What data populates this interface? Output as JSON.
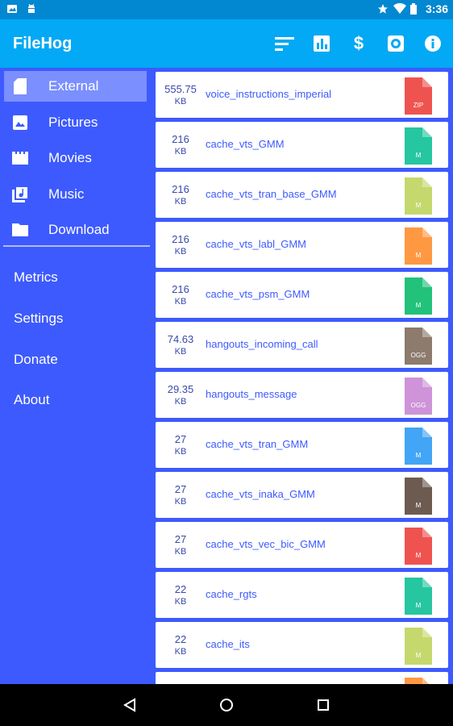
{
  "status_bar": {
    "time": "3:36",
    "icons": [
      "photo-notification-icon",
      "android-icon",
      "star-icon",
      "wifi-icon",
      "battery-icon"
    ]
  },
  "app_bar": {
    "title": "FileHog",
    "actions": [
      "sort-icon",
      "chart-icon",
      "dollar-icon",
      "settings-icon",
      "info-icon"
    ]
  },
  "drawer": {
    "items": [
      {
        "label": "External",
        "icon": "sd-card-icon",
        "selected": true
      },
      {
        "label": "Pictures",
        "icon": "image-icon"
      },
      {
        "label": "Movies",
        "icon": "movie-icon"
      },
      {
        "label": "Music",
        "icon": "music-library-icon"
      },
      {
        "label": "Download",
        "icon": "folder-icon"
      }
    ],
    "links": [
      "Metrics",
      "Settings",
      "Donate",
      "About"
    ]
  },
  "files": [
    {
      "size": "555.75",
      "unit": "KB",
      "name": "voice_instructions_imperial",
      "ext": "ZIP",
      "color": "#ef5350"
    },
    {
      "size": "216",
      "unit": "KB",
      "name": "cache_vts_GMM",
      "ext": "M",
      "color": "#26c6a0"
    },
    {
      "size": "216",
      "unit": "KB",
      "name": "cache_vts_tran_base_GMM",
      "ext": "M",
      "color": "#c5d86d"
    },
    {
      "size": "216",
      "unit": "KB",
      "name": "cache_vts_labl_GMM",
      "ext": "M",
      "color": "#ff9843"
    },
    {
      "size": "216",
      "unit": "KB",
      "name": "cache_vts_psm_GMM",
      "ext": "M",
      "color": "#22c27a"
    },
    {
      "size": "74.63",
      "unit": "KB",
      "name": "hangouts_incoming_call",
      "ext": "OGG",
      "color": "#8d7b6d"
    },
    {
      "size": "29.35",
      "unit": "KB",
      "name": "hangouts_message",
      "ext": "OGG",
      "color": "#ce93d8"
    },
    {
      "size": "27",
      "unit": "KB",
      "name": "cache_vts_tran_GMM",
      "ext": "M",
      "color": "#42a5f5"
    },
    {
      "size": "27",
      "unit": "KB",
      "name": "cache_vts_inaka_GMM",
      "ext": "M",
      "color": "#6d5b52"
    },
    {
      "size": "27",
      "unit": "KB",
      "name": "cache_vts_vec_bic_GMM",
      "ext": "M",
      "color": "#ef5350"
    },
    {
      "size": "22",
      "unit": "KB",
      "name": "cache_rgts",
      "ext": "M",
      "color": "#26c6a0"
    },
    {
      "size": "22",
      "unit": "KB",
      "name": "cache_its",
      "ext": "M",
      "color": "#c5d86d"
    },
    {
      "size": "",
      "unit": "",
      "name": "",
      "ext": "",
      "color": "#ff9843"
    }
  ],
  "nav_bar": {
    "buttons": [
      "back-icon",
      "home-icon",
      "recents-icon"
    ]
  }
}
